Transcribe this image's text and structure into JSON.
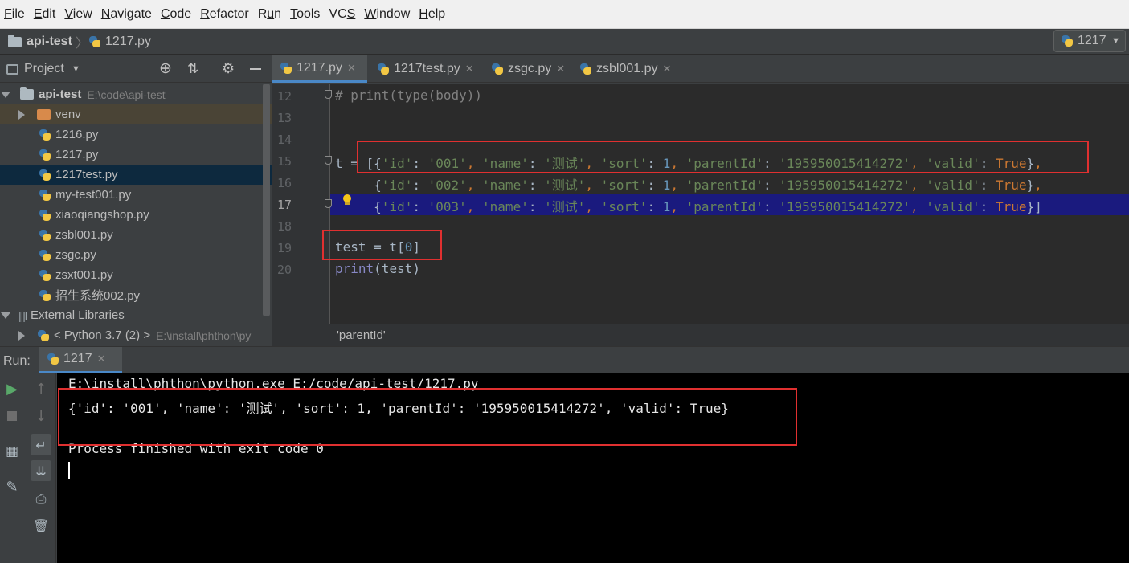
{
  "menu": [
    "File",
    "Edit",
    "View",
    "Navigate",
    "Code",
    "Refactor",
    "Run",
    "Tools",
    "VCS",
    "Window",
    "Help"
  ],
  "menu_mnemonic": [
    "F",
    "E",
    "V",
    "N",
    "C",
    "R",
    "u",
    "T",
    "S",
    "W",
    "H"
  ],
  "navbar": {
    "project": "api-test",
    "file": "1217.py",
    "run_config": "1217"
  },
  "project_panel": {
    "title": "Project",
    "tree": [
      {
        "label": "api-test",
        "hint": "E:\\code\\api-test",
        "kind": "root"
      },
      {
        "label": "venv",
        "kind": "folder"
      },
      {
        "label": "1216.py",
        "kind": "file"
      },
      {
        "label": "1217.py",
        "kind": "file"
      },
      {
        "label": "1217test.py",
        "kind": "file"
      },
      {
        "label": "my-test001.py",
        "kind": "file"
      },
      {
        "label": "xiaoqiangshop.py",
        "kind": "file"
      },
      {
        "label": "zsbl001.py",
        "kind": "file"
      },
      {
        "label": "zsgc.py",
        "kind": "file"
      },
      {
        "label": "zsxt001.py",
        "kind": "file"
      },
      {
        "label": "招生系统002.py",
        "kind": "file"
      },
      {
        "label": "External Libraries",
        "kind": "lib"
      },
      {
        "label": "< Python 3.7 (2) >",
        "hint": "E:\\install\\phthon\\py",
        "kind": "sdk"
      }
    ]
  },
  "editor": {
    "tabs": [
      "1217.py",
      "1217test.py",
      "zsgc.py",
      "zsbl001.py"
    ],
    "active_tab": "1217.py",
    "line_numbers": [
      "12",
      "13",
      "14",
      "15",
      "16",
      "17",
      "18",
      "19",
      "20"
    ],
    "code": {
      "l12": "# print(type(body))",
      "l15_pre": "t = [",
      "row1": {
        "id": "'001'",
        "name": "'测试'",
        "sort": "1",
        "parentId": "'195950015414272'",
        "valid": "True"
      },
      "row2": {
        "id": "'002'",
        "name": "'测试'",
        "sort": "1",
        "parentId": "'195950015414272'",
        "valid": "True"
      },
      "row3": {
        "id": "'003'",
        "name": "'测试'",
        "sort": "1",
        "parentId": "'195950015414272'",
        "valid": "True"
      },
      "k_id": "'id'",
      "k_name": "'name'",
      "k_sort": "'sort'",
      "k_parentId": "'parentId'",
      "k_valid": "'valid'",
      "l19_var": "test",
      "l19_eq": " = t[",
      "l19_idx": "0",
      "l19_close": "]",
      "l20_fn": "print",
      "l20_args": "(test)"
    },
    "breadcrumb": "'parentId'"
  },
  "run": {
    "label": "Run:",
    "tab": "1217",
    "console": [
      "E:\\install\\phthon\\python.exe E:/code/api-test/1217.py",
      "{'id': '001', 'name': '测试', 'sort': 1, 'parentId': '195950015414272', 'valid': True}",
      "",
      "Process finished with exit code 0"
    ]
  },
  "colors": {
    "accent": "#4a88c7",
    "highlight_row": "#1a1a7e",
    "annotation": "#e03030",
    "string": "#6a8759",
    "number": "#6897bb",
    "keyword": "#cc7832"
  }
}
